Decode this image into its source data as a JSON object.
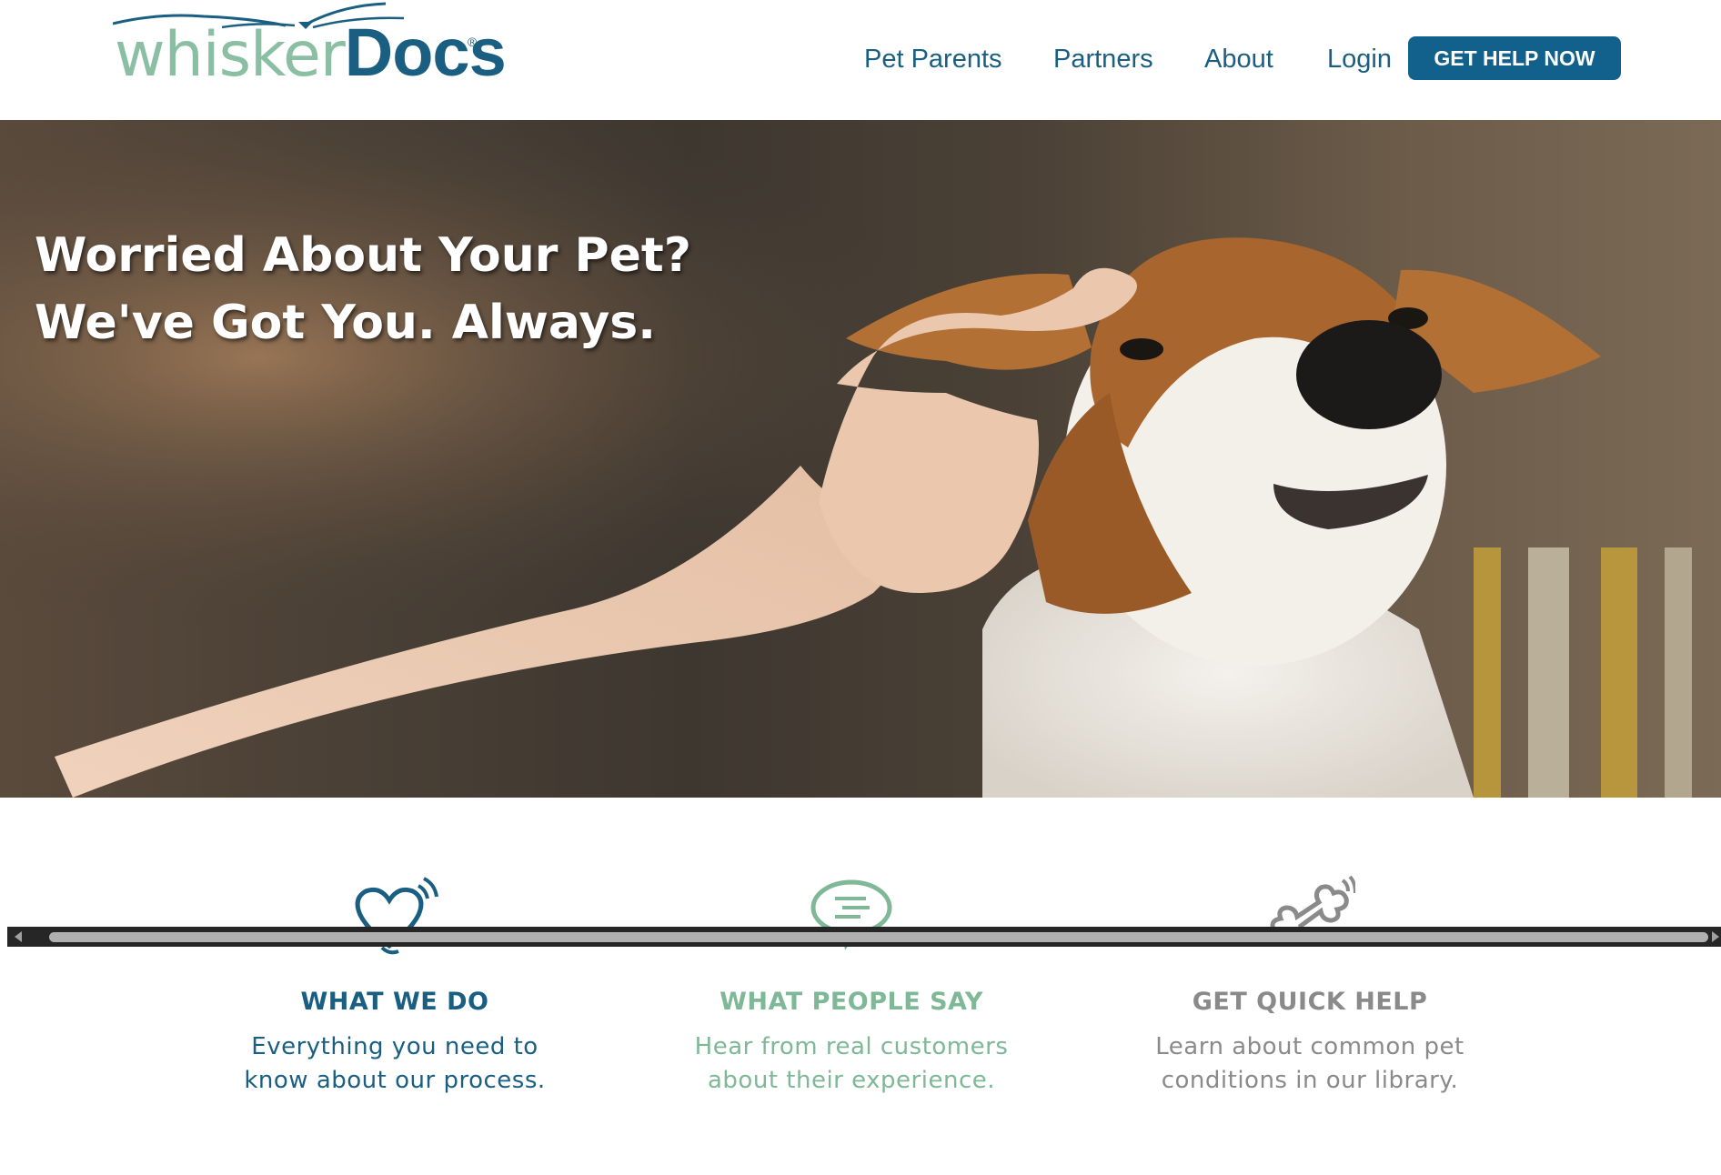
{
  "brand": {
    "logo_part1": "whisker",
    "logo_part2": "Docs",
    "logo_mark": "®",
    "primary_color": "#1a5f82",
    "secondary_color": "#8bbfa4"
  },
  "nav": {
    "items": [
      {
        "label": "Pet Parents"
      },
      {
        "label": "Partners"
      },
      {
        "label": "About"
      },
      {
        "label": "Login"
      }
    ],
    "cta_label": "GET HELP NOW"
  },
  "hero": {
    "heading_line1": "Worried About Your Pet?",
    "heading_line2": "We've Got You. Always."
  },
  "features": [
    {
      "icon": "heart-icon",
      "title": "WHAT WE DO",
      "desc_line1": "Everything you need to",
      "desc_line2": "know about our process.",
      "color": "#1a5f82"
    },
    {
      "icon": "chat-bubble-icon",
      "title": "WHAT PEOPLE SAY",
      "desc_line1": "Hear from real customers",
      "desc_line2": "about their experience.",
      "color": "#7fb896"
    },
    {
      "icon": "bone-icon",
      "title": "GET QUICK HELP",
      "desc_line1": "Learn about common pet",
      "desc_line2": "conditions in our library.",
      "color": "#8a8a8a"
    }
  ]
}
